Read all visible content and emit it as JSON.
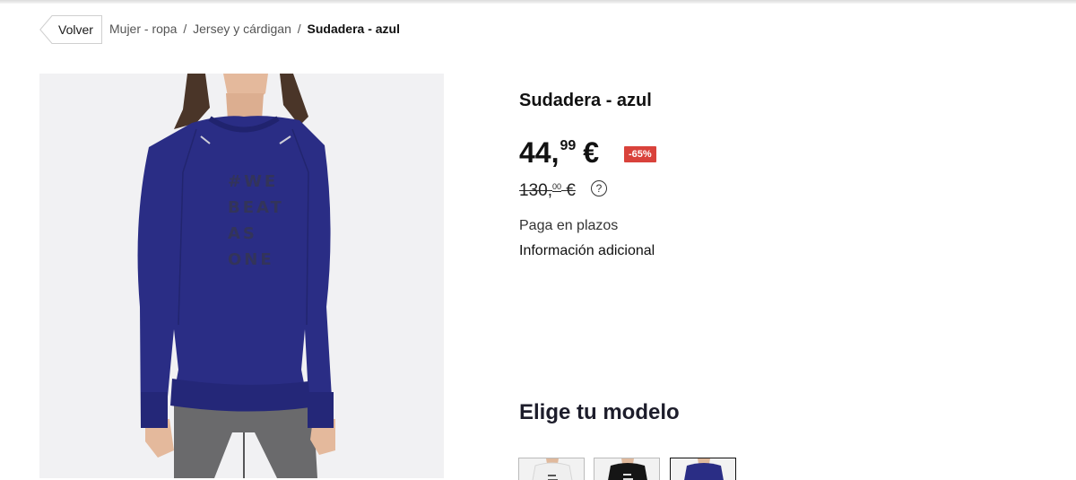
{
  "breadcrumb": {
    "back_label": "Volver",
    "items": [
      "Mujer - ropa",
      "Jersey y cárdigan"
    ],
    "separator": "/",
    "current": "Sudadera - azul"
  },
  "product": {
    "title": "Sudadera - azul",
    "price_int": "44,",
    "price_dec": "99",
    "currency": "€",
    "discount": "-65%",
    "old_price_int": "130,",
    "old_price_dec": "00",
    "old_currency": "€",
    "help_glyph": "?",
    "installments": "Paga en plazos",
    "additional_info": "Información adicional",
    "print_lines": [
      "#WE",
      "BEAT",
      "AS",
      "ONE"
    ]
  },
  "models": {
    "heading": "Elige tu modelo",
    "thumbnails": [
      "white-sweatshirt",
      "black-sweatshirt",
      "navy-sweatshirt"
    ]
  },
  "colors": {
    "sweatshirt": "#2a2d85",
    "discount_badge": "#d9423b",
    "jeans": "#6a6a6c"
  },
  "icons": {
    "back": "chevron-left-outline-icon",
    "help": "question-circle-icon"
  }
}
